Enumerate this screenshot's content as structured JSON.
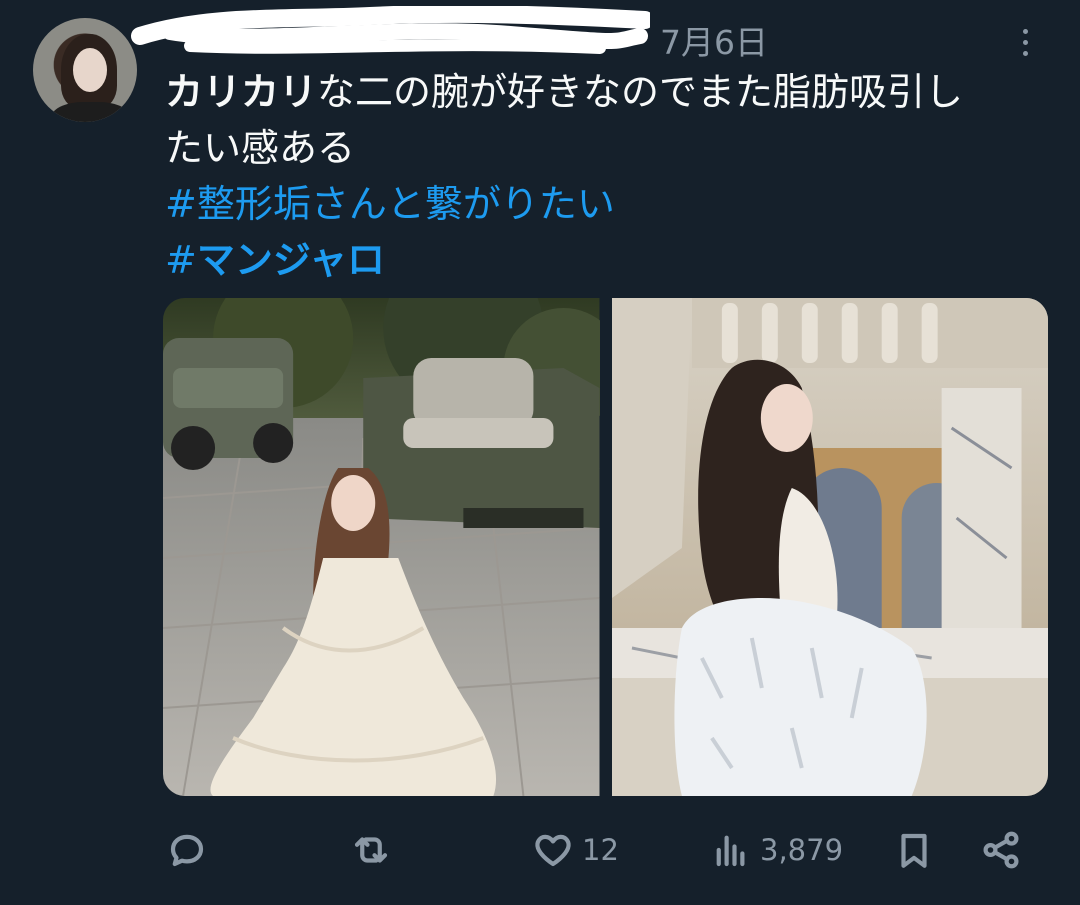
{
  "tweet": {
    "date": "7月6日",
    "text": {
      "bold_lead": "カリカリ",
      "line1_rest": "な二の腕が好きなのでまた脂肪吸引し",
      "line2": "たい感ある"
    },
    "hashtags": [
      {
        "hash": "#",
        "label": "整形垢さんと繋がりたい"
      },
      {
        "hash": "#",
        "label": "マンジャロ"
      }
    ],
    "media": [
      {
        "icon": "photo-golf-cart-woman-white-dress"
      },
      {
        "icon": "photo-woman-fur-balcony"
      }
    ],
    "actions": {
      "reply": {
        "icon": "reply-icon",
        "count": ""
      },
      "retweet": {
        "icon": "retweet-icon",
        "count": ""
      },
      "like": {
        "icon": "heart-icon",
        "count": "12"
      },
      "views": {
        "icon": "views-icon",
        "count": "3,879"
      },
      "bookmark": {
        "icon": "bookmark-icon",
        "count": ""
      },
      "share": {
        "icon": "share-icon",
        "count": ""
      }
    }
  }
}
